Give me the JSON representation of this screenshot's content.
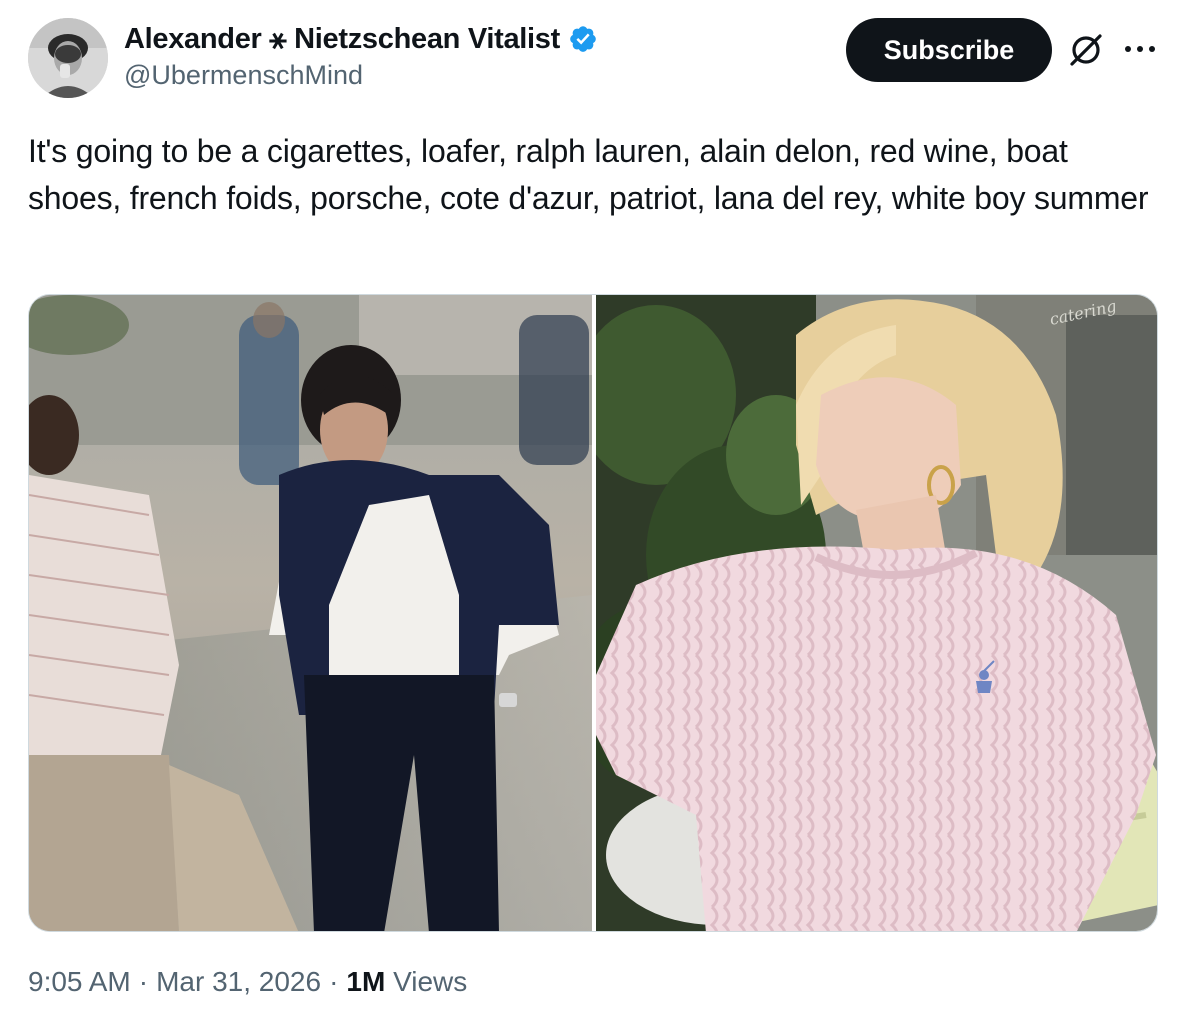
{
  "author": {
    "display_name": "Alexander ⚹ Nietzschean Vitalist",
    "handle": "@UbermenschMind",
    "verified": true
  },
  "actions": {
    "subscribe_label": "Subscribe"
  },
  "tweet": {
    "text": "It's going to be a cigarettes, loafer, ralph lauren, alain delon, red wine, boat shoes, french foids, porsche, cote d'azur, patriot, lana del rey, white boy summer"
  },
  "media": {
    "photos": [
      {
        "icon": "photo-man-navy-sweater-white-shirt"
      },
      {
        "icon": "photo-woman-pink-cable-knit-sweater"
      }
    ]
  },
  "meta": {
    "time": "9:05 AM",
    "separator": "·",
    "date": "Mar 31, 2026",
    "views_count": "1M",
    "views_label": "Views"
  },
  "colors": {
    "text_primary": "#0f1419",
    "text_secondary": "#536471",
    "verified_blue": "#1d9bf0",
    "button_bg": "#0f1419"
  }
}
